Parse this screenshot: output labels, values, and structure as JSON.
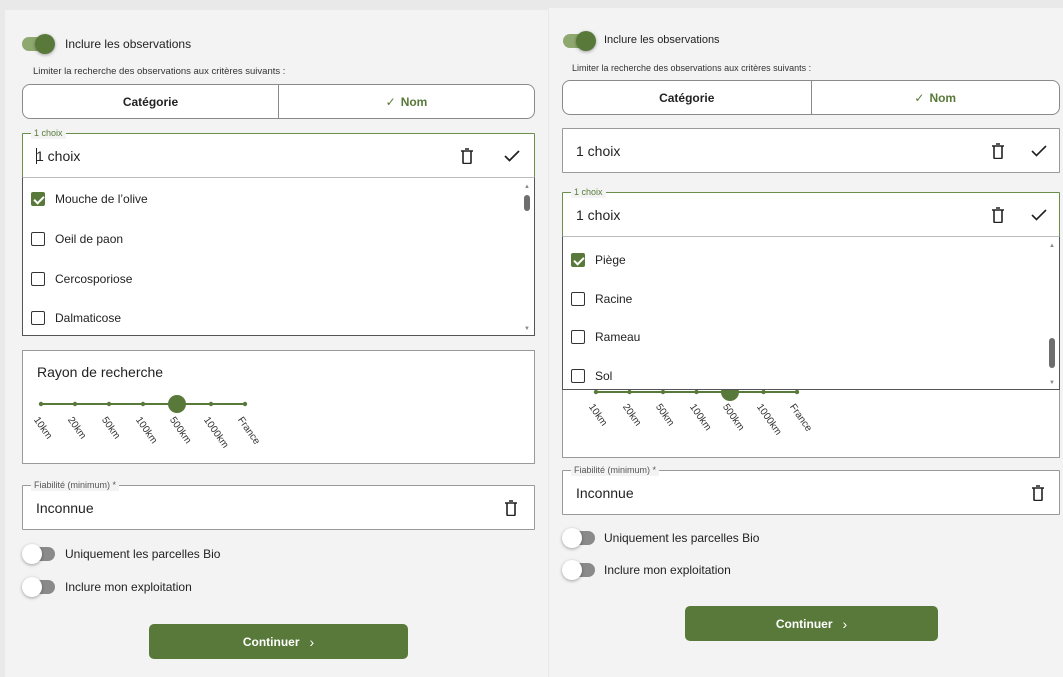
{
  "left": {
    "include_observations": "Inclure les observations",
    "limit_caption": "Limiter la recherche des observations aux critères suivants :",
    "segments": {
      "category": "Catégorie",
      "name": "Nom"
    },
    "choice_field": {
      "legend": "1 choix",
      "value": "1 choix"
    },
    "list": [
      {
        "label": "Mouche de l’olive",
        "checked": true
      },
      {
        "label": "Oeil de paon",
        "checked": false
      },
      {
        "label": "Cercosporiose",
        "checked": false
      },
      {
        "label": "Dalmaticose",
        "checked": false
      }
    ],
    "radius": {
      "title": "Rayon de recherche",
      "ticks": [
        "10km",
        "20km",
        "50km",
        "100km",
        "500km",
        "1000km",
        "France"
      ],
      "selected_index": 4
    },
    "reliability": {
      "legend": "Fiabilité (minimum) *",
      "value": "Inconnue"
    },
    "bio_only": "Uniquement les parcelles Bio",
    "include_farm": "Inclure mon exploitation",
    "continue": "Continuer"
  },
  "right": {
    "include_observations": "Inclure les observations",
    "limit_caption": "Limiter la recherche des observations aux critères suivants :",
    "segments": {
      "category": "Catégorie",
      "name": "Nom"
    },
    "choice_field_1": {
      "value": "1 choix"
    },
    "choice_field_2": {
      "legend": "1 choix",
      "value": "1 choix"
    },
    "list": [
      {
        "label": "Piège",
        "checked": true
      },
      {
        "label": "Racine",
        "checked": false
      },
      {
        "label": "Rameau",
        "checked": false
      },
      {
        "label": "Sol",
        "checked": false
      }
    ],
    "radius": {
      "ticks": [
        "10km",
        "20km",
        "50km",
        "100km",
        "500km",
        "1000km",
        "France"
      ],
      "selected_index": 4
    },
    "reliability": {
      "legend": "Fiabilité (minimum) *",
      "value": "Inconnue"
    },
    "bio_only": "Uniquement les parcelles Bio",
    "include_farm": "Inclure mon exploitation",
    "continue": "Continuer"
  },
  "colors": {
    "accent": "#58793a",
    "accent_light": "#8fa870",
    "panel": "#f3f3f3"
  },
  "icons": {
    "check": "check-icon",
    "trash": "trash-icon",
    "chevron": "chevron-right-icon"
  }
}
